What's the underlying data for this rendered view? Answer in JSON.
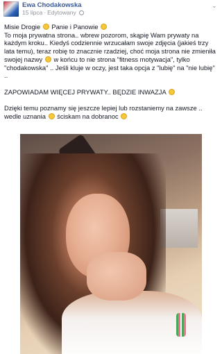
{
  "post": {
    "author": "Ewa Chodakowska",
    "date": "15 lipca",
    "separator": "·",
    "edited": "Edytowany",
    "paragraphs": [
      [
        "Misie Drogie ",
        "Panie i Panowie "
      ],
      [
        "To moja prywatna strona.. wbrew pozorom, skąpię Wam prywaty na każdym kroku.. Kiedyś codziennie wrzucałam swoje zdjęcia (jakieś trzy lata temu), teraz robię to znacznie rzadziej, choć moja strona nie zmieniła swojej nazwy ",
        " w końcu to nie strona \"fitness motywacja\", tylko \"chodakowska\" .. Jeśli kluje w oczy, jest taka opcja z \"lubię\" na \"nie lubię\" .."
      ],
      [
        "ZAPOWIADAM WIĘCEJ PRYWATY.. BĘDZIE INWAZJA "
      ],
      [
        "Dzięki temu poznamy się jeszcze lepiej lub rozstaniemy na zawsze .. wedle uznania ",
        " ściskam na dobranoc "
      ]
    ]
  },
  "icons": {
    "avatar": "avatar-image",
    "privacy": "globe-icon",
    "menu": "chevron-down-icon",
    "emoji": "smiley-emoji-icon",
    "photo": "selfie-photo"
  }
}
